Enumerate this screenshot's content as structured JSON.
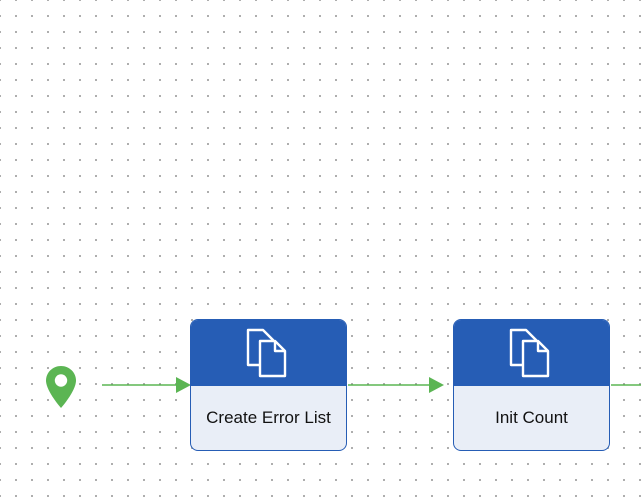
{
  "diagram": {
    "start_icon": "map-pin-icon",
    "nodes": [
      {
        "id": "create-error-list",
        "label": "Create Error List",
        "icon": "copy-documents-icon"
      },
      {
        "id": "init-count",
        "label": "Init Count",
        "icon": "copy-documents-icon"
      }
    ],
    "edges": [
      {
        "from": "start",
        "to": "create-error-list"
      },
      {
        "from": "create-error-list",
        "to": "init-count"
      },
      {
        "from": "init-count",
        "to": "next"
      }
    ]
  },
  "colors": {
    "node_header": "#265db5",
    "node_body": "#e9eef7",
    "connector": "#5bb553",
    "start_marker": "#5bb553",
    "grid_dot": "#9a9a9a"
  }
}
